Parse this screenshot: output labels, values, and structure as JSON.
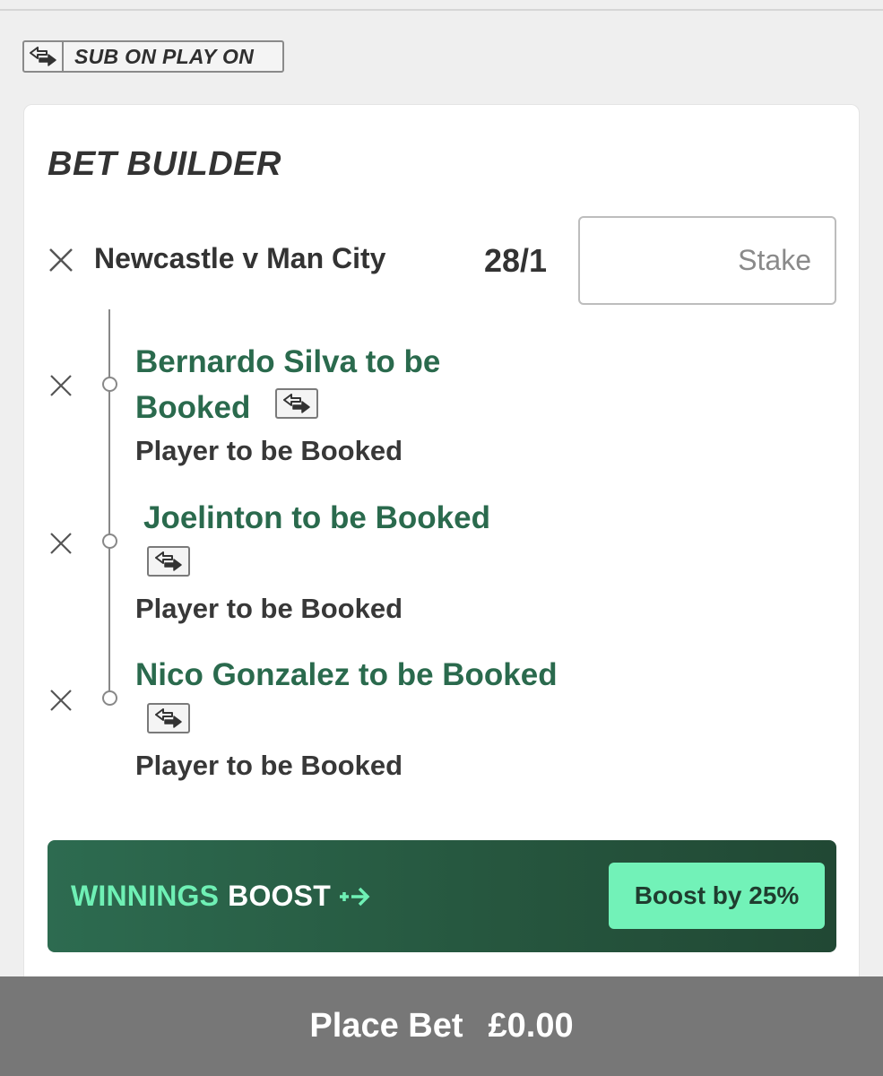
{
  "sub_on_play_on": {
    "label": "SUB ON PLAY ON"
  },
  "bet_builder": {
    "title": "BET BUILDER",
    "event": {
      "name": "Newcastle v Man City",
      "odds": "28/1",
      "stake_placeholder": "Stake",
      "stake_value": ""
    },
    "selections": [
      {
        "title_line1": "Bernardo Silva to be",
        "title_line2": "Booked",
        "market": "Player to be Booked"
      },
      {
        "title_line1": "Joelinton to be Booked",
        "market": "Player to be Booked"
      },
      {
        "title_line1": "Nico Gonzalez to be Booked",
        "market": "Player to be Booked"
      }
    ]
  },
  "boost": {
    "label_green": "WINNINGS",
    "label_white": "BOOST",
    "button_label": "Boost by 25%"
  },
  "place_bet": {
    "label": "Place Bet",
    "amount": "£0.00"
  },
  "colors": {
    "selection_green": "#2a6a4d",
    "boost_accent": "#72f2b8",
    "banner_dark": "#26573f",
    "place_bar": "#777777"
  },
  "icons": {
    "remove": "close-icon",
    "substitute": "swap-icon",
    "boost_arrow": "boost-arrow-icon"
  }
}
